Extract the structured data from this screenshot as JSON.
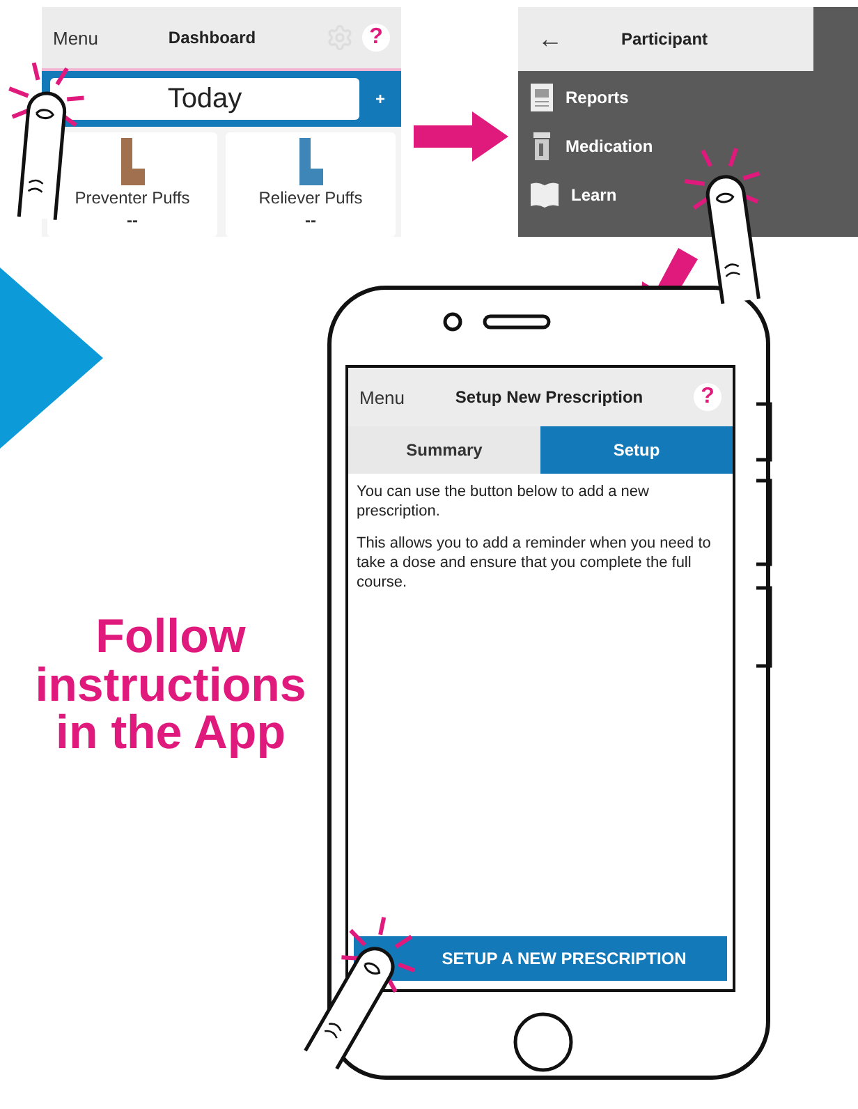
{
  "dashboard": {
    "menu": "Menu",
    "title": "Dashboard",
    "help": "?",
    "date": "Today",
    "add": "+",
    "cards": [
      {
        "label": "Preventer Puffs",
        "value": "--",
        "color": "#a0704f"
      },
      {
        "label": "Reliever Puffs",
        "value": "--",
        "color": "#3f86b8"
      }
    ]
  },
  "participant": {
    "back": "←",
    "title": "Participant",
    "items": [
      {
        "label": "Reports",
        "kind": "reports"
      },
      {
        "label": "Medication",
        "kind": "medication"
      },
      {
        "label": "Learn",
        "kind": "learn"
      }
    ]
  },
  "phone": {
    "menu": "Menu",
    "title": "Setup New Prescription",
    "help": "?",
    "tabs": [
      {
        "label": "Summary",
        "selected": false
      },
      {
        "label": "Setup",
        "selected": true
      }
    ],
    "paragraphs": [
      "You can use the button below to add a new prescription.",
      "This allows you to add a reminder when you need to take a dose and ensure that you complete the full course."
    ],
    "button": "SETUP A NEW PRESCRIPTION"
  },
  "caption": [
    "Follow",
    "instructions",
    "in the App"
  ]
}
